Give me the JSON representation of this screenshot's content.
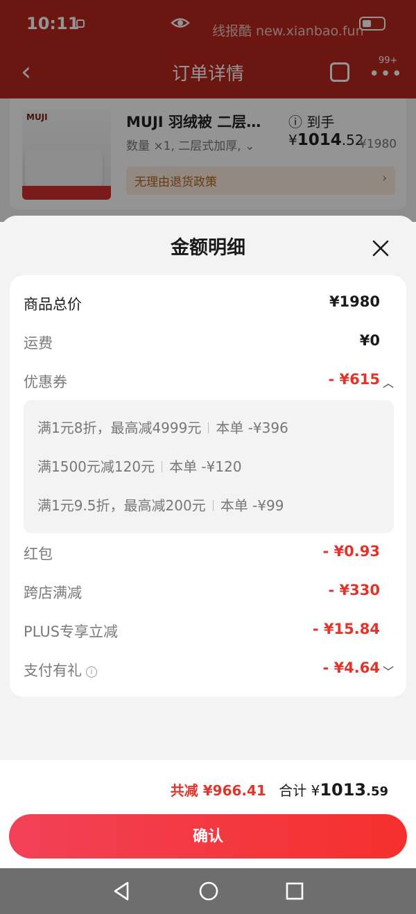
{
  "status": {
    "time": "10:11",
    "watermark": "线报酷  new.xianbao.fun"
  },
  "header": {
    "title": "订单详情",
    "badge": "99+"
  },
  "product": {
    "brand_image_text": "MUJI",
    "name": "MUJI 羽绒被 二层…",
    "net_price_label": "到手¥",
    "net_price_int": "1014",
    "net_price_dec": ".52",
    "spec": "数量 ×1, 二层式加厚,",
    "original_price": "¥1980",
    "policy": "无理由退货政策"
  },
  "sheet": {
    "title": "金额明细",
    "rows": {
      "goods_total": {
        "label": "商品总价",
        "value": "¥1980"
      },
      "shipping": {
        "label": "运费",
        "value": "¥0"
      },
      "coupon": {
        "label": "优惠券",
        "value": "- ¥615"
      },
      "red_packet": {
        "label": "红包",
        "value": "- ¥0.93"
      },
      "cross_store": {
        "label": "跨店满减",
        "value": "- ¥330"
      },
      "plus": {
        "label": "PLUS专享立减",
        "value": "- ¥15.84"
      },
      "pay_gift": {
        "label": "支付有礼",
        "value": "- ¥4.64"
      }
    },
    "coupons": [
      {
        "rule": "满1元8折，最高减4999元",
        "applied": "本单 -¥396"
      },
      {
        "rule": "满1500元减120元",
        "applied": "本单 -¥120"
      },
      {
        "rule": "满1元9.5折，最高减200元",
        "applied": "本单 -¥99"
      }
    ]
  },
  "footer": {
    "total_cut": "共减 ¥966.41",
    "sum_label": "合计 ¥",
    "sum_int": "1013",
    "sum_dec": ".59",
    "confirm": "确认"
  },
  "colors": {
    "accent_red": "#e2342b",
    "header_red": "#b9261c"
  }
}
